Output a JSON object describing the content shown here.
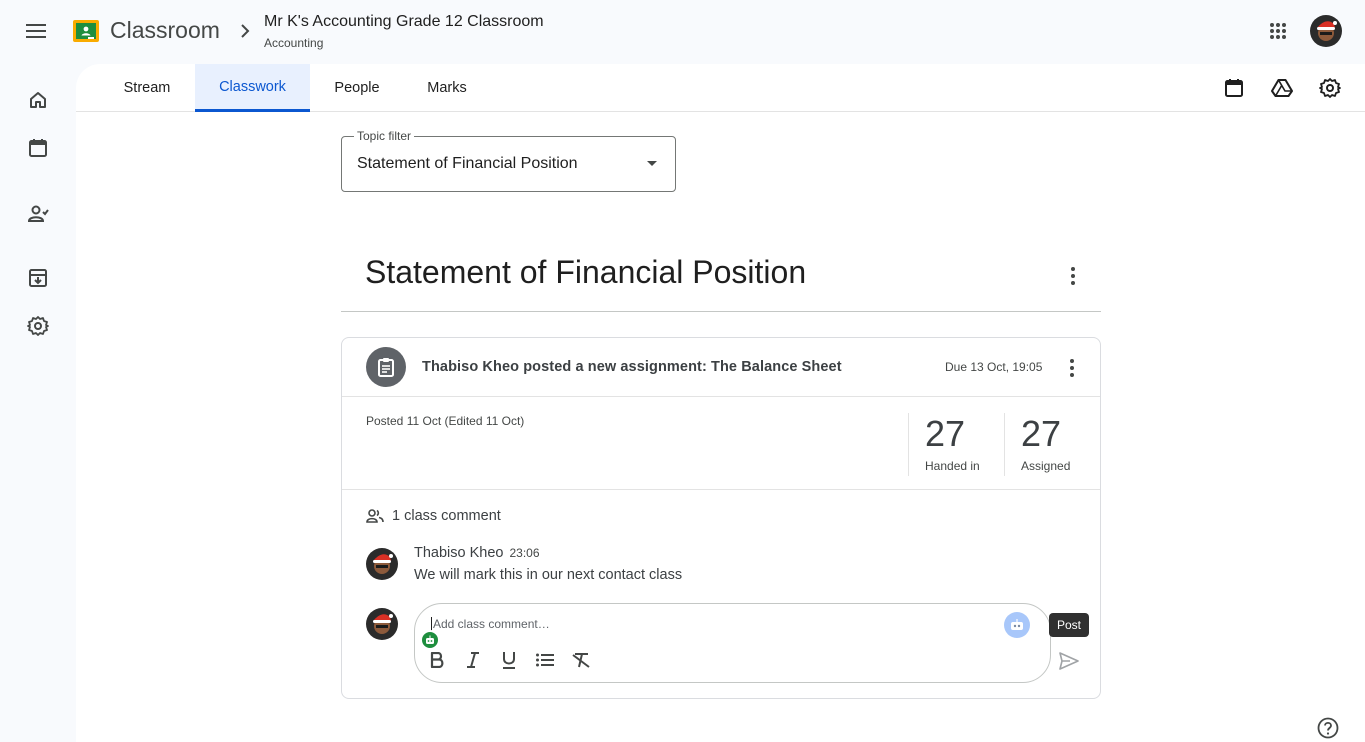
{
  "header": {
    "app_name": "Classroom",
    "class_title": "Mr K's Accounting Grade 12 Classroom",
    "class_subtitle": "Accounting"
  },
  "rail": {
    "items": [
      "home-icon",
      "calendar-icon",
      "enrolled-icon",
      "archive-icon",
      "settings-icon"
    ]
  },
  "tabs": {
    "stream": "Stream",
    "classwork": "Classwork",
    "people": "People",
    "marks": "Marks",
    "active": "Classwork"
  },
  "filter": {
    "label": "Topic filter",
    "value": "Statement of Financial Position"
  },
  "topic": {
    "title": "Statement of Financial Position"
  },
  "assignment": {
    "title": "Thabiso Kheo posted a new assignment: The Balance Sheet",
    "due": "Due 13 Oct, 19:05",
    "posted": "Posted 11 Oct (Edited 11 Oct)",
    "stats": [
      {
        "value": "27",
        "label": "Handed in"
      },
      {
        "value": "27",
        "label": "Assigned"
      }
    ]
  },
  "comments": {
    "count_label": "1 class comment",
    "items": [
      {
        "author": "Thabiso Kheo",
        "time": "23:06",
        "text": "We will mark this in our next contact class"
      }
    ],
    "compose_placeholder": "Add class comment…",
    "send_tooltip": "Post"
  },
  "colors": {
    "accent": "#0b57d0",
    "active_tab_bg": "#e8f0fe",
    "page_bg": "#f8fafd"
  }
}
